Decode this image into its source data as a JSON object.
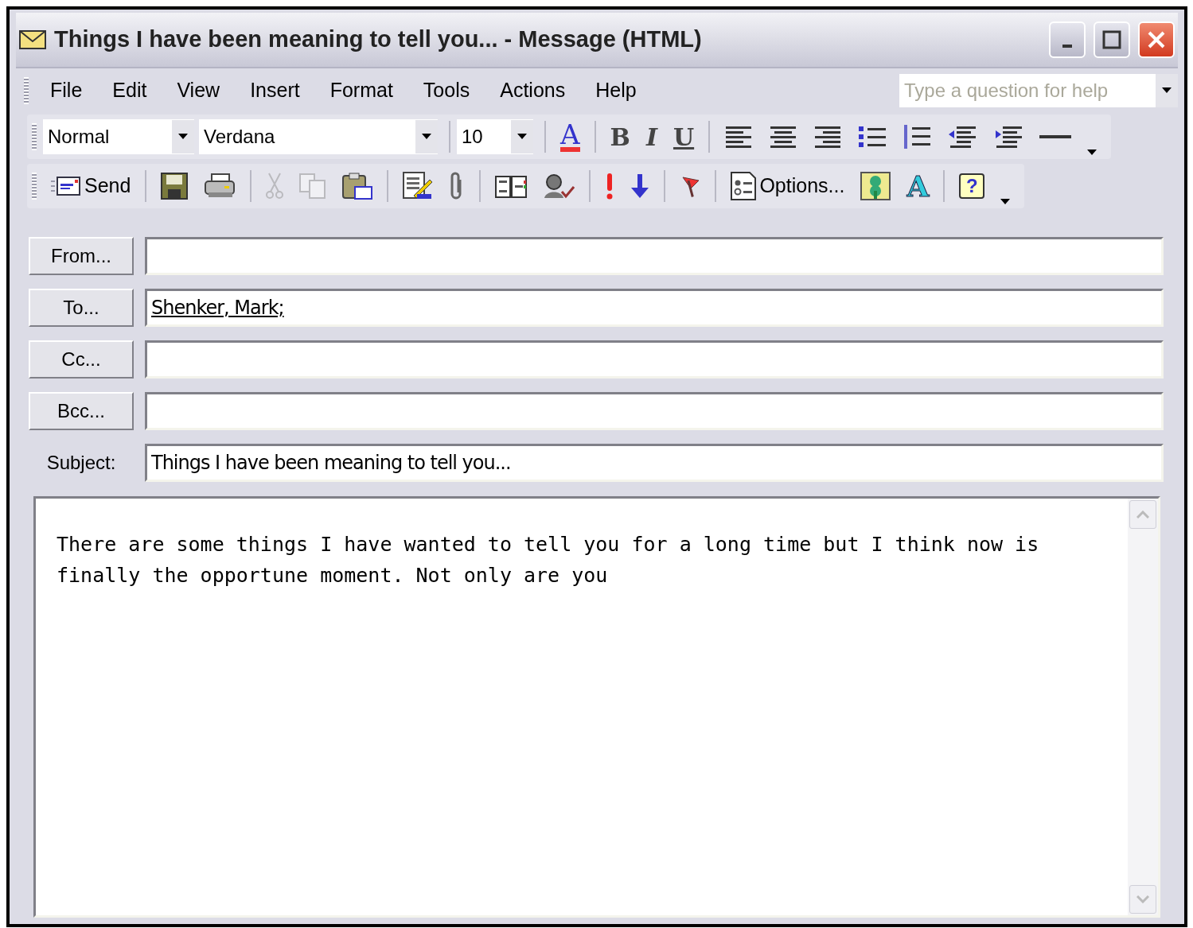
{
  "window": {
    "title": "Things I have been meaning to tell you... - Message (HTML)"
  },
  "menu": [
    {
      "label": "File"
    },
    {
      "label": "Edit"
    },
    {
      "label": "View"
    },
    {
      "label": "Insert"
    },
    {
      "label": "Format"
    },
    {
      "label": "Tools"
    },
    {
      "label": "Actions"
    },
    {
      "label": "Help"
    }
  ],
  "help_search": {
    "placeholder": "Type a question for help"
  },
  "format_toolbar": {
    "style": "Normal",
    "font": "Verdana",
    "size": "10",
    "groups": [
      [
        {
          "kind": "fontcolor",
          "label": "A"
        }
      ],
      [
        {
          "kind": "bold",
          "label": "B"
        },
        {
          "kind": "italic",
          "label": "I"
        },
        {
          "kind": "underline",
          "label": "U"
        }
      ],
      [
        {
          "kind": "alignleft"
        },
        {
          "kind": "center"
        },
        {
          "kind": "alignright"
        },
        {
          "kind": "bullets"
        },
        {
          "kind": "numbering"
        },
        {
          "kind": "outdent"
        },
        {
          "kind": "indent"
        },
        {
          "kind": "hline"
        },
        {
          "kind": "more"
        }
      ]
    ]
  },
  "standard_toolbar": {
    "groups": [
      [
        {
          "kind": "send",
          "label": "Send",
          "disabled": false
        }
      ],
      [
        {
          "kind": "save",
          "disabled": false
        },
        {
          "kind": "print",
          "disabled": false
        }
      ],
      [
        {
          "kind": "cut",
          "disabled": true
        },
        {
          "kind": "copy",
          "disabled": true
        },
        {
          "kind": "paste",
          "disabled": false
        }
      ],
      [
        {
          "kind": "signature",
          "disabled": false
        },
        {
          "kind": "attach",
          "disabled": false
        }
      ],
      [
        {
          "kind": "addressbook",
          "disabled": false
        },
        {
          "kind": "checknames",
          "disabled": false
        }
      ],
      [
        {
          "kind": "high",
          "disabled": false
        },
        {
          "kind": "low",
          "disabled": false
        }
      ],
      [
        {
          "kind": "flag",
          "disabled": false
        }
      ],
      [
        {
          "kind": "options",
          "label": "Options...",
          "disabled": false
        },
        {
          "kind": "stationery",
          "disabled": false
        },
        {
          "kind": "fontsize",
          "label": "A",
          "disabled": false
        }
      ],
      [
        {
          "kind": "help",
          "label": "?",
          "disabled": false
        },
        {
          "kind": "more",
          "disabled": false
        }
      ]
    ]
  },
  "fields": [
    {
      "kind": "button",
      "label": "From..."
    },
    {
      "kind": "button",
      "label": "To...",
      "value": "Shenker, Mark;"
    },
    {
      "kind": "button",
      "label": "Cc..."
    },
    {
      "kind": "button",
      "label": "Bcc..."
    },
    {
      "kind": "label",
      "label": "Subject:",
      "value": "Things I have been meaning to tell you..."
    }
  ],
  "body": {
    "text": "There are some things I have wanted to tell you for a long time but I think now is finally the opportune moment. Not only are you"
  }
}
